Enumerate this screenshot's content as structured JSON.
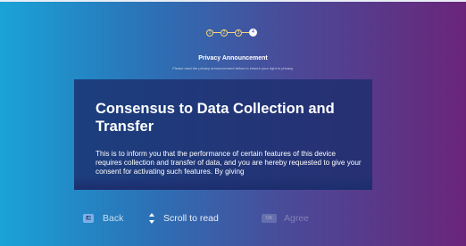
{
  "header": {
    "steps": [
      "1",
      "2",
      "3",
      "4"
    ],
    "active_step": 4,
    "title": "Privacy Announcement",
    "subtitle": "Please read the privacy announcement below to ensure your right to privacy."
  },
  "card": {
    "heading": "Consensus to Data Collection and Transfer",
    "body": "This is to inform you that the performance of certain features of this device requires collection and transfer of data, and you are hereby requested to give your consent for activating such features. By giving"
  },
  "footer": {
    "back_label": "Back",
    "scroll_label": "Scroll to read",
    "ok_key_label": "OK",
    "agree_label": "Agree"
  },
  "colors": {
    "gradient_left": "#1aa3d8",
    "gradient_right": "#6a257a",
    "card_bg": "#1c2e6e",
    "step_accent": "#f3d67a"
  },
  "icons": {
    "back": "back-arrow-icon",
    "scroll": "up-down-arrows-icon",
    "ok": "ok-key-icon"
  }
}
